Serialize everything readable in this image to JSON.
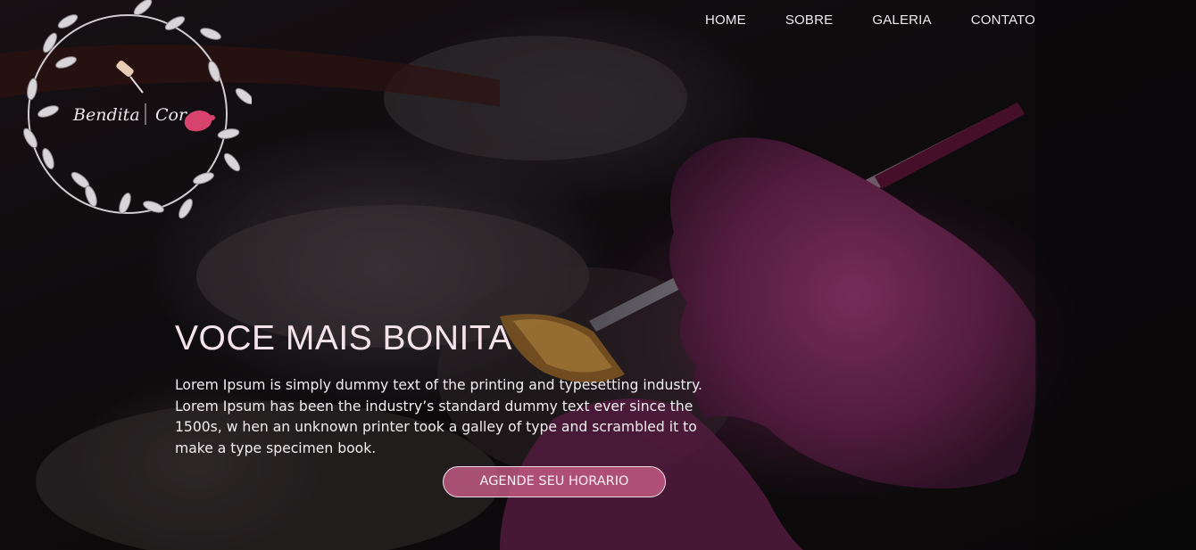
{
  "logo": {
    "text_left": "Bendita",
    "text_right": "Cor"
  },
  "nav": {
    "items": [
      {
        "label": "HOME"
      },
      {
        "label": "SOBRE"
      },
      {
        "label": "GALERIA"
      },
      {
        "label": "CONTATO"
      }
    ]
  },
  "hero": {
    "title": "VOCE MAIS BONITA",
    "description": "Lorem Ipsum is simply dummy text of the printing and typesetting industry. Lorem Ipsum has been the industry’s standard dummy text ever since the 1500s, w hen an unknown printer took a galley of type and scrambled it to make a type specimen book.",
    "cta_label": "AGENDE SEU HORARIO"
  },
  "colors": {
    "accent": "#c45c84",
    "glove": "#8a2f66",
    "text": "#f2eef1"
  }
}
